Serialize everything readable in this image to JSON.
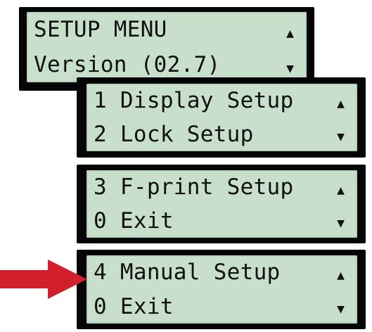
{
  "panels": [
    {
      "line1": "SETUP MENU",
      "line2": "Version (02.7)"
    },
    {
      "line1": "1 Display Setup",
      "line2": "2 Lock Setup"
    },
    {
      "line1": "3 F-print Setup",
      "line2": "0 Exit"
    },
    {
      "line1": "4 Manual Setup",
      "line2": "0 Exit"
    }
  ],
  "scroll": {
    "up": "▲",
    "down": "▼"
  },
  "colors": {
    "screen": "#c7dfcb",
    "bezel": "#050505",
    "pointer": "#d11f2c"
  },
  "icons": {
    "pointer": "red-arrow-icon"
  }
}
